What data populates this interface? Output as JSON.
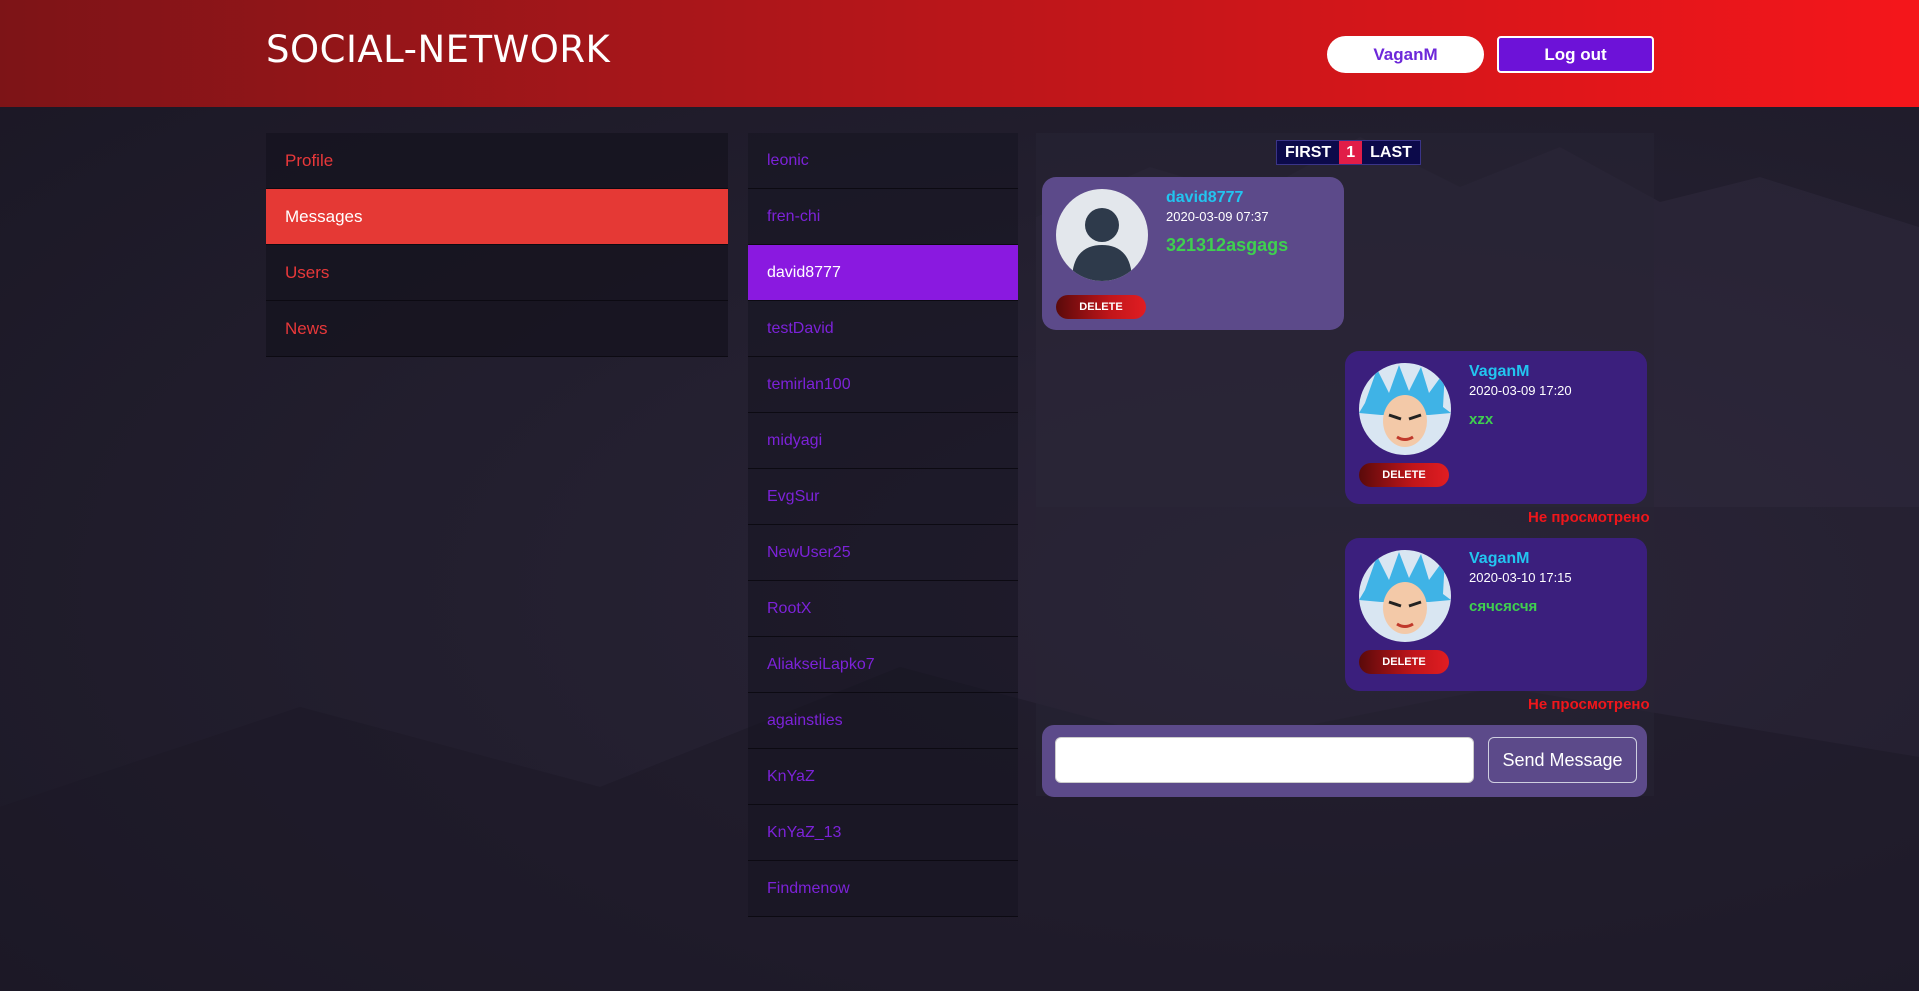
{
  "header": {
    "logo": "SOCIAL-NETWORK",
    "user_button": "VaganM",
    "logout_button": "Log out"
  },
  "nav": {
    "items": [
      {
        "label": "Profile",
        "active": false
      },
      {
        "label": "Messages",
        "active": true
      },
      {
        "label": "Users",
        "active": false
      },
      {
        "label": "News",
        "active": false
      }
    ]
  },
  "dialogs": {
    "items": [
      {
        "name": "leonic"
      },
      {
        "name": "fren-chi"
      },
      {
        "name": "david8777"
      },
      {
        "name": "testDavid"
      },
      {
        "name": "temirlan100"
      },
      {
        "name": "midyagi"
      },
      {
        "name": "EvgSur"
      },
      {
        "name": "NewUser25"
      },
      {
        "name": "RootX"
      },
      {
        "name": "AliakseiLapko7"
      },
      {
        "name": "againstlies"
      },
      {
        "name": "KnYaZ"
      },
      {
        "name": "KnYaZ_13"
      },
      {
        "name": "Findmenow"
      }
    ],
    "active_name": "david8777"
  },
  "pager": {
    "first": "FIRST",
    "current": "1",
    "last": "LAST"
  },
  "messages": [
    {
      "author": "david8777",
      "time": "2020-03-09 07:37",
      "text": "321312asgags",
      "delete": "DELETE",
      "direction": "incoming",
      "avatar": "default-avatar"
    },
    {
      "author": "VaganM",
      "time": "2020-03-09 17:20",
      "text": "xzx",
      "delete": "DELETE",
      "direction": "outgoing",
      "avatar": "anime-avatar",
      "status": "Не просмотрено"
    },
    {
      "author": "VaganM",
      "time": "2020-03-10 17:15",
      "text": "сячсясчя",
      "delete": "DELETE",
      "direction": "outgoing",
      "avatar": "anime-avatar",
      "status": "Не просмотрено"
    }
  ],
  "composer": {
    "input_value": "",
    "send_button": "Send Message"
  },
  "colors": {
    "header_start": "#7d1417",
    "header_end": "#f5161b",
    "nav_active": "#e53935",
    "dialog_active": "#8a19e0",
    "dialog_text": "#7c22d8",
    "author": "#22c5f0",
    "message_text": "#3fd04f",
    "unread": "#f0161b"
  }
}
